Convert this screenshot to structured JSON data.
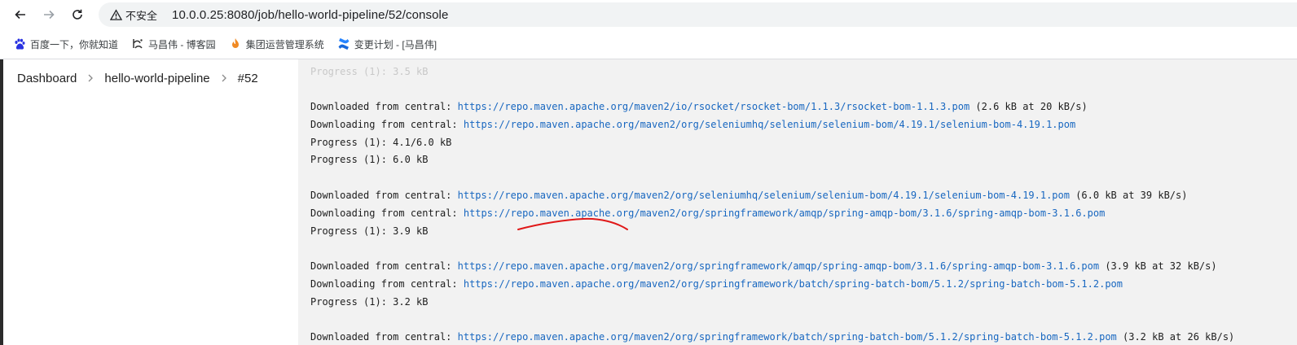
{
  "browser": {
    "security_label": "不安全",
    "url": "10.0.0.25:8080/job/hello-world-pipeline/52/console",
    "bookmarks": [
      {
        "label": "百度一下，你就知道",
        "icon": "baidu-paw-icon"
      },
      {
        "label": "马昌伟 - 博客园",
        "icon": "cnblogs-icon"
      },
      {
        "label": "集团运营管理系统",
        "icon": "flame-logo-icon"
      },
      {
        "label": "变更计划 - [马昌伟]",
        "icon": "confluence-icon"
      }
    ]
  },
  "breadcrumb": {
    "items": [
      "Dashboard",
      "hello-world-pipeline",
      "#52"
    ]
  },
  "console": {
    "ghost_text": "Progress (1): 3.5 kB",
    "lines": [
      {
        "prefix": "Downloaded from central: ",
        "link": "https://repo.maven.apache.org/maven2/io/rsocket/rsocket-bom/1.1.3/rsocket-bom-1.1.3.pom",
        "suffix": " (2.6 kB at 20 kB/s)"
      },
      {
        "prefix": "Downloading from central: ",
        "link": "https://repo.maven.apache.org/maven2/org/seleniumhq/selenium/selenium-bom/4.19.1/selenium-bom-4.19.1.pom",
        "suffix": ""
      },
      {
        "prefix": "Progress (1): 4.1/6.0 kB",
        "link": "",
        "suffix": ""
      },
      {
        "prefix": "Progress (1): 6.0 kB",
        "link": "",
        "suffix": ""
      },
      {
        "prefix": "",
        "link": "",
        "suffix": ""
      },
      {
        "prefix": "Downloaded from central: ",
        "link": "https://repo.maven.apache.org/maven2/org/seleniumhq/selenium/selenium-bom/4.19.1/selenium-bom-4.19.1.pom",
        "suffix": " (6.0 kB at 39 kB/s)"
      },
      {
        "prefix": "Downloading from central: ",
        "link": "https://repo.maven.apache.org/maven2/org/springframework/amqp/spring-amqp-bom/3.1.6/spring-amqp-bom-3.1.6.pom",
        "suffix": ""
      },
      {
        "prefix": "Progress (1): 3.9 kB",
        "link": "",
        "suffix": ""
      },
      {
        "prefix": "",
        "link": "",
        "suffix": ""
      },
      {
        "prefix": "Downloaded from central: ",
        "link": "https://repo.maven.apache.org/maven2/org/springframework/amqp/spring-amqp-bom/3.1.6/spring-amqp-bom-3.1.6.pom",
        "suffix": " (3.9 kB at 32 kB/s)"
      },
      {
        "prefix": "Downloading from central: ",
        "link": "https://repo.maven.apache.org/maven2/org/springframework/batch/spring-batch-bom/5.1.2/spring-batch-bom-5.1.2.pom",
        "suffix": ""
      },
      {
        "prefix": "Progress (1): 3.2 kB",
        "link": "",
        "suffix": ""
      },
      {
        "prefix": "",
        "link": "",
        "suffix": ""
      },
      {
        "prefix": "Downloaded from central: ",
        "link": "https://repo.maven.apache.org/maven2/org/springframework/batch/spring-batch-bom/5.1.2/spring-batch-bom-5.1.2.pom",
        "suffix": " (3.2 kB at 26 kB/s)"
      }
    ]
  },
  "colors": {
    "link": "#1867c0",
    "annotation": "#e01818",
    "console_bg": "#f2f2f2"
  }
}
